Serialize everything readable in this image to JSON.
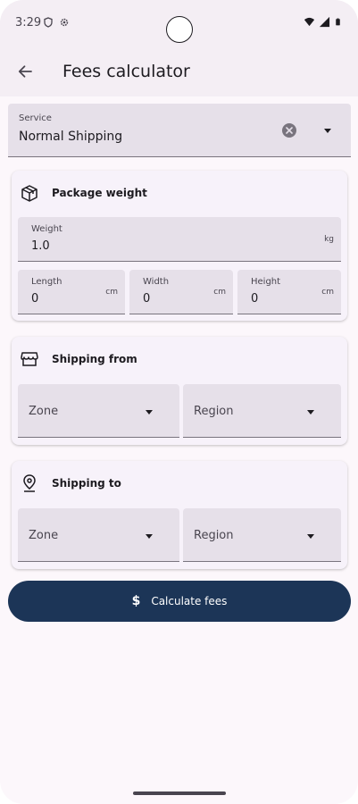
{
  "status_bar": {
    "time": "3:29"
  },
  "app_bar": {
    "title": "Fees calculator"
  },
  "service": {
    "label": "Service",
    "value": "Normal Shipping"
  },
  "package_weight": {
    "title": "Package weight",
    "weight": {
      "label": "Weight",
      "value": "1.0",
      "unit": "kg"
    },
    "length": {
      "label": "Length",
      "value": "0",
      "unit": "cm"
    },
    "width": {
      "label": "Width",
      "value": "0",
      "unit": "cm"
    },
    "height": {
      "label": "Height",
      "value": "0",
      "unit": "cm"
    }
  },
  "shipping_from": {
    "title": "Shipping from",
    "zone_placeholder": "Zone",
    "region_placeholder": "Region"
  },
  "shipping_to": {
    "title": "Shipping to",
    "zone_placeholder": "Zone",
    "region_placeholder": "Region"
  },
  "calculate_button": {
    "icon": "$",
    "label": "Calculate fees"
  },
  "colors": {
    "primary": "#1c3557",
    "background": "#fcf7fb",
    "field": "#e6e0e9",
    "card": "#f7f2fa"
  },
  "icons": [
    "arrow-back-icon",
    "clear-icon",
    "package-icon",
    "store-icon",
    "location-pin-icon",
    "dollar-icon"
  ]
}
